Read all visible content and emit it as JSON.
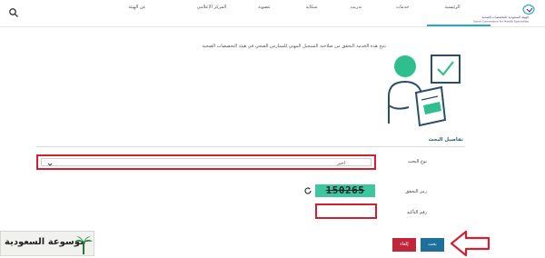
{
  "header": {
    "nav": [
      {
        "id": "home",
        "label": "الرئيسية"
      },
      {
        "id": "services",
        "label": "خدمات"
      },
      {
        "id": "training",
        "label": "تدريب"
      },
      {
        "id": "complaints",
        "label": "شكاية"
      },
      {
        "id": "membership",
        "label": "عضوية"
      },
      {
        "id": "media",
        "label": "المركز الاعلامي"
      },
      {
        "id": "about",
        "label": "عن الهيئة"
      }
    ],
    "logo_line1": "الهيئة السعودية للتخصصات الصحية",
    "logo_line2": "Saudi Commission for Health Specialties"
  },
  "intro": "تتيح هذه الخدمة التحقق من صلاحية التسجيل المهني للممارس الصحي في هيئة التخصصات الصحية",
  "form": {
    "section_title": "تفاصيل البحث",
    "search_type_label": "نوع البحث",
    "search_type_value": "اختر",
    "captcha_label": "رمز التحقق",
    "captcha_code": "150265",
    "confirm_label": "رقم التأكيد",
    "confirm_value": ""
  },
  "buttons": {
    "search": "بحث",
    "cancel": "إلغاء"
  },
  "colors": {
    "accent": "#2aa8c1",
    "highlight_frame": "#d1202f",
    "captcha_bg": "#3cc7a0",
    "search_button": "#1f6f9b",
    "cancel_button": "#c0263a"
  },
  "watermark": {
    "text": "موسوعة السعودية"
  }
}
